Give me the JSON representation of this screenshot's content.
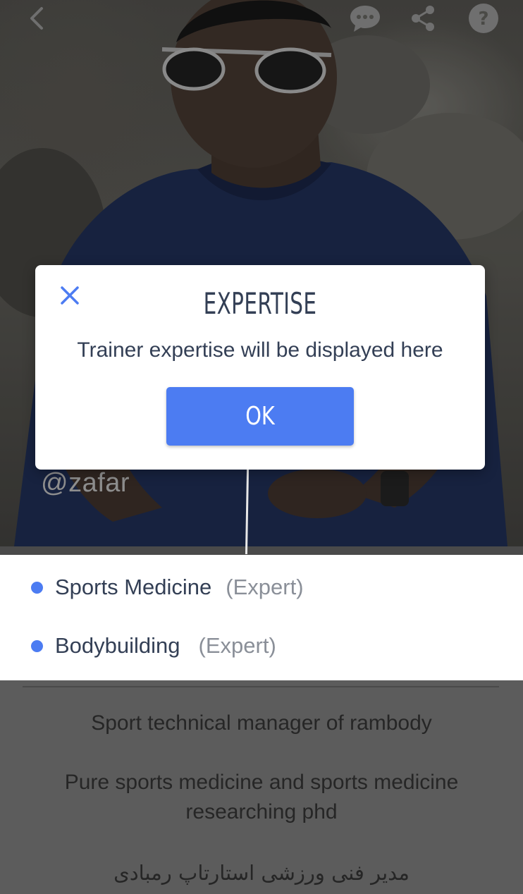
{
  "header": {
    "icons": [
      "back-icon",
      "chat-icon",
      "share-icon",
      "help-icon"
    ]
  },
  "profile": {
    "username": "@zafar"
  },
  "dialog": {
    "title": "EXPERTISE",
    "message": "Trainer expertise will be displayed here",
    "ok_label": "OK",
    "close_icon": "close-icon"
  },
  "expertise": [
    {
      "name": "Sports Medicine",
      "level": "(Expert)"
    },
    {
      "name": "Bodybuilding",
      "level": "(Expert)"
    }
  ],
  "bio": {
    "line1": "Sport technical manager of rambody",
    "line2": "Pure sports medicine and sports medicine researching phd",
    "line3": "مدیر فنی ورزشی استارتاپ رمبادی"
  },
  "colors": {
    "accent": "#4c7cf2",
    "text_dark": "#333f55",
    "text_muted": "#8a8f98",
    "overlay": "#5c5c5c"
  }
}
